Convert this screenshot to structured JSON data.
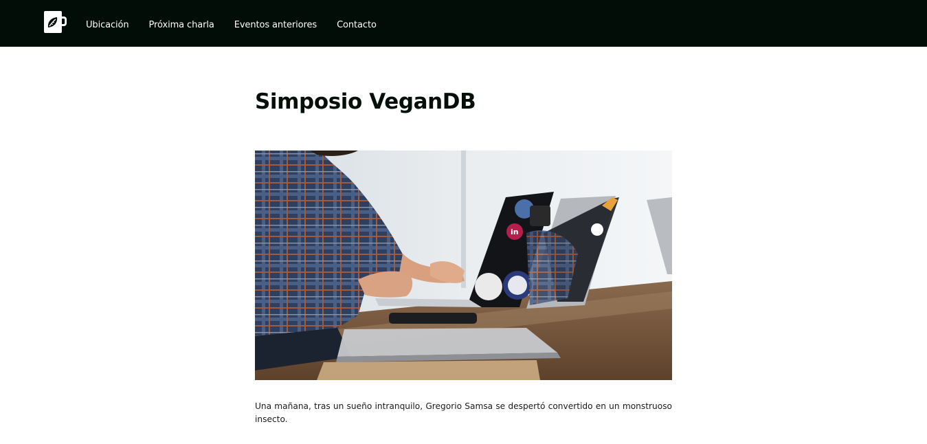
{
  "header": {
    "logo_icon": "coffee-mug-leaf-icon",
    "nav": [
      {
        "label": "Ubicación"
      },
      {
        "label": "Próxima charla"
      },
      {
        "label": "Eventos anteriores"
      },
      {
        "label": "Contacto"
      }
    ]
  },
  "main": {
    "title": "Simposio VeganDB",
    "hero_image": "photo of a person typing on a sticker-covered laptop at a wooden table",
    "paragraph": "Una mañana, tras un sueño intranquilo, Gregorio Samsa se despertó convertido en un monstruoso insecto."
  },
  "colors": {
    "header_bg": "#020d07",
    "nav_text": "#ffffff",
    "title_text": "#050f0a"
  }
}
